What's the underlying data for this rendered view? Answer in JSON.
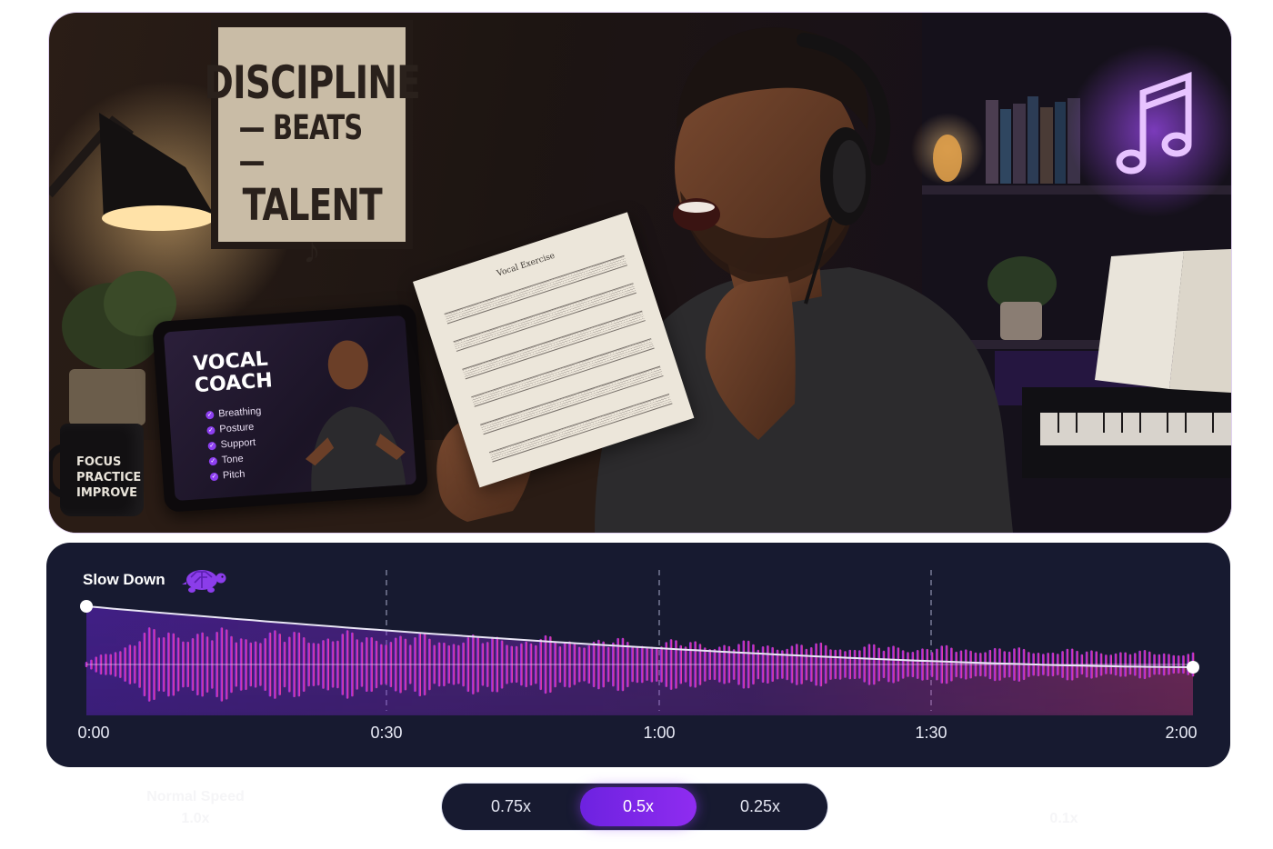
{
  "scene": {
    "poster_lines": [
      "DISCIPLINE",
      "— BEATS —",
      "TALENT"
    ],
    "poster_note": "♪",
    "tablet": {
      "title": "VOCAL COACH",
      "items": [
        "Breathing",
        "Posture",
        "Support",
        "Tone",
        "Pitch"
      ]
    },
    "mug_lines": [
      "FOCUS",
      "PRACTICE",
      "IMPROVE"
    ],
    "sheet_title": "Vocal Exercise"
  },
  "speed_panel": {
    "label": "Slow Down",
    "icon": "turtle-icon",
    "time_labels": [
      "0:00",
      "0:30",
      "1:00",
      "1:30",
      "2:00"
    ],
    "duration_seconds": 120,
    "playback_rate_curve": {
      "start": 1.0,
      "end": 0.5
    },
    "colors": {
      "wave_start": "#7a2cf0",
      "wave_end": "#ff3f95",
      "card_bg": "#171a30"
    }
  },
  "speed_selector": {
    "options": [
      "0.75x",
      "0.5x",
      "0.25x"
    ],
    "selected": "0.5x",
    "faded_left_label": "Normal Speed",
    "faded_left_value": "1.0x",
    "faded_right_value": "0.1x",
    "accent": "#8a2be2"
  }
}
